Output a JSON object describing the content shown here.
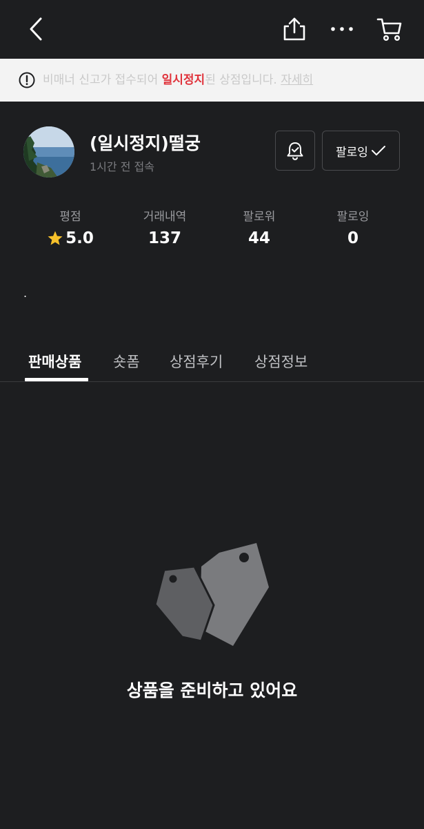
{
  "topbar": {
    "back": "back-icon",
    "share": "share-icon",
    "more": "more-icon",
    "cart": "cart-icon"
  },
  "banner": {
    "icon": "warning-icon",
    "prefix": "비매너 신고가 접수되어 ",
    "highlight": "일시정지",
    "suffix": "된 상점입니다. ",
    "link": "자세히",
    "highlight_color": "#e0323b"
  },
  "profile": {
    "name": "(일시정지)떨궁",
    "last_seen": "1시간 전 접속",
    "follow_label": "팔로잉"
  },
  "stats": [
    {
      "label": "평점",
      "value": "5.0"
    },
    {
      "label": "거래내역",
      "value": "137"
    },
    {
      "label": "팔로워",
      "value": "44"
    },
    {
      "label": "팔로잉",
      "value": "0"
    }
  ],
  "description": ".",
  "tabs": [
    {
      "label": "판매상품",
      "active": true
    },
    {
      "label": "숏폼"
    },
    {
      "label": "상점후기"
    },
    {
      "label": "상점정보"
    }
  ],
  "empty": {
    "message": "상품을 준비하고 있어요"
  }
}
